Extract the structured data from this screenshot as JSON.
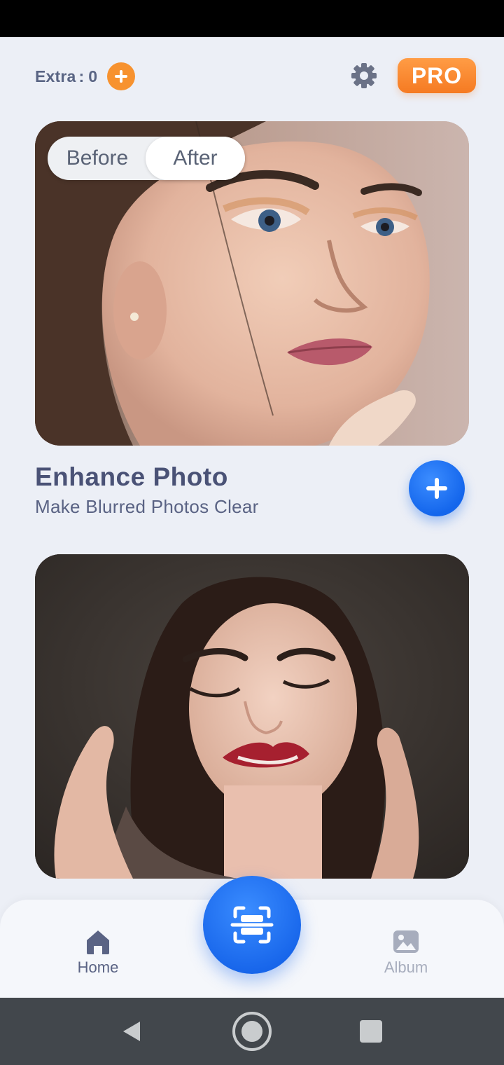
{
  "header": {
    "extra_label": "Extra",
    "extra_separator": ":",
    "extra_count": "0",
    "pro_label": "PRO",
    "settings_icon": "gear-icon",
    "add_extra_icon": "plus-icon"
  },
  "feature_card": {
    "toggle": {
      "before_label": "Before",
      "after_label": "After",
      "selected": "After"
    },
    "title": "Enhance Photo",
    "subtitle": "Make Blurred Photos Clear",
    "add_icon": "plus-icon"
  },
  "bottom_nav": {
    "home_label": "Home",
    "album_label": "Album",
    "scan_icon": "scan-icon",
    "active": "Home"
  },
  "colors": {
    "accent_orange": "#f7922f",
    "accent_blue": "#1766ea",
    "background": "#eceff6",
    "title_text": "#4a5276"
  }
}
